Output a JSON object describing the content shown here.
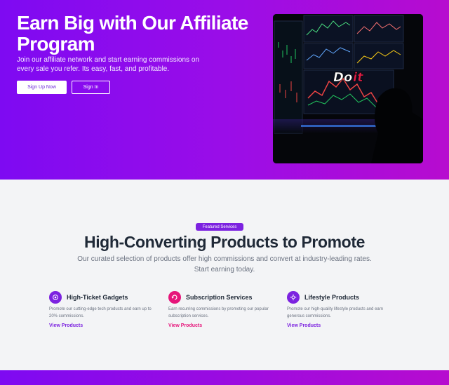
{
  "hero": {
    "title": "Earn Big with Our Affiliate Program",
    "subtitle": "Join our affiliate network and start earning commissions on every sale you refer. Its easy, fast, and profitable.",
    "primary_button": "Sign Up Now",
    "secondary_button": "Sign In",
    "image_text_1": "Do",
    "image_text_2": "it"
  },
  "featured": {
    "badge": "Featured Services",
    "title": "High-Converting Products to Promote",
    "subtitle": "Our curated selection of products offer high commissions and convert at industry-leading rates. Start earning today."
  },
  "cards": [
    {
      "title": "High-Ticket Gadgets",
      "description": "Promote our cutting-edge tech products and earn up to 20% commissions.",
      "link": "View Products",
      "icon": "gadget-icon",
      "color": "#7c22e0"
    },
    {
      "title": "Subscription Services",
      "description": "Earn recurring commissions by promoting our popular subscription services.",
      "link": "View Products",
      "icon": "subscription-icon",
      "color": "#e6157a"
    },
    {
      "title": "Lifestyle Products",
      "description": "Promote our high-quality lifestyle products and earn generous commissions.",
      "link": "View Products",
      "icon": "lifestyle-icon",
      "color": "#7c22e0"
    }
  ]
}
